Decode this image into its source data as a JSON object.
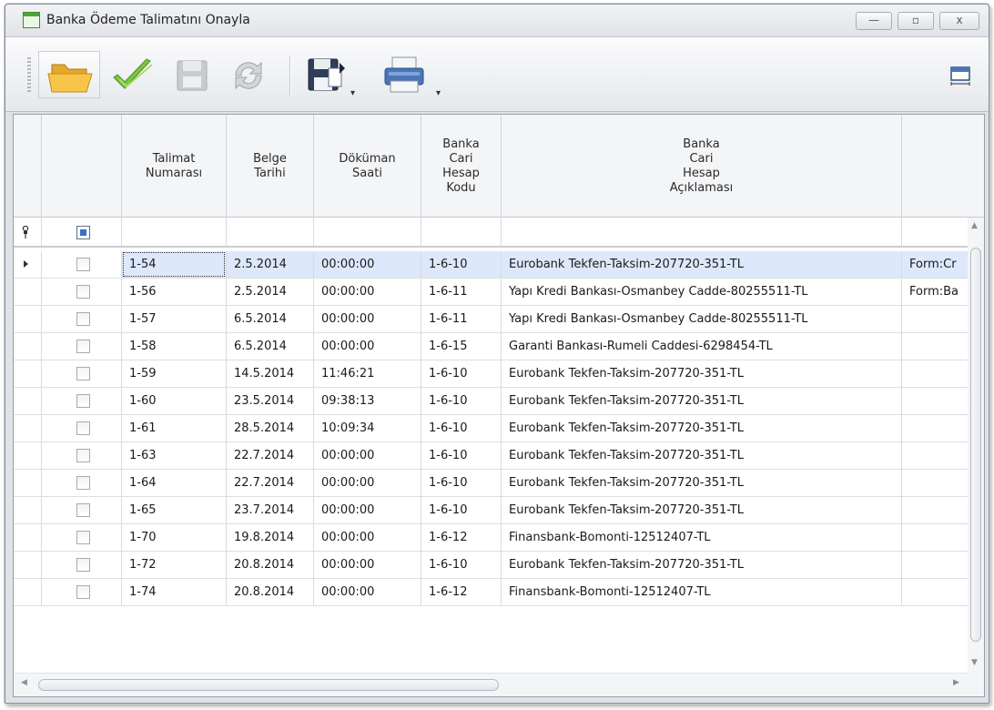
{
  "window": {
    "title": "Banka Ödeme Talimatını Onayla",
    "buttons": {
      "minimize": "—",
      "maximize": "▫",
      "close": "x"
    }
  },
  "toolbar": {
    "icons": [
      "folder-open-icon",
      "checkmark-icon",
      "save-icon",
      "refresh-icon",
      "export-icon",
      "print-icon",
      "column-fit-icon"
    ]
  },
  "grid": {
    "columns": [
      {
        "key": "indicator",
        "label": ""
      },
      {
        "key": "select",
        "label": ""
      },
      {
        "key": "talimat_no",
        "label": "Talimat\nNumarası"
      },
      {
        "key": "belge_tarihi",
        "label": "Belge\nTarihi"
      },
      {
        "key": "dokuman_saati",
        "label": "Döküman\nSaati"
      },
      {
        "key": "cari_kodu",
        "label": "Banka\nCari\nHesap\nKodu"
      },
      {
        "key": "cari_aciklama",
        "label": "Banka\nCari\nHesap\nAçıklaması"
      },
      {
        "key": "extra",
        "label": ""
      }
    ],
    "rows": [
      {
        "talimat_no": "1-54",
        "belge_tarihi": "2.5.2014",
        "dokuman_saati": "00:00:00",
        "cari_kodu": "1-6-10",
        "cari_aciklama": "Eurobank Tekfen-Taksim-207720-351-TL",
        "extra": "Form:Cr"
      },
      {
        "talimat_no": "1-56",
        "belge_tarihi": "2.5.2014",
        "dokuman_saati": "00:00:00",
        "cari_kodu": "1-6-11",
        "cari_aciklama": "Yapı Kredi Bankası-Osmanbey Cadde-80255511-TL",
        "extra": "Form:Ba"
      },
      {
        "talimat_no": "1-57",
        "belge_tarihi": "6.5.2014",
        "dokuman_saati": "00:00:00",
        "cari_kodu": "1-6-11",
        "cari_aciklama": "Yapı Kredi Bankası-Osmanbey Cadde-80255511-TL",
        "extra": ""
      },
      {
        "talimat_no": "1-58",
        "belge_tarihi": "6.5.2014",
        "dokuman_saati": "00:00:00",
        "cari_kodu": "1-6-15",
        "cari_aciklama": "Garanti Bankası-Rumeli Caddesi-6298454-TL",
        "extra": ""
      },
      {
        "talimat_no": "1-59",
        "belge_tarihi": "14.5.2014",
        "dokuman_saati": "11:46:21",
        "cari_kodu": "1-6-10",
        "cari_aciklama": "Eurobank Tekfen-Taksim-207720-351-TL",
        "extra": ""
      },
      {
        "talimat_no": "1-60",
        "belge_tarihi": "23.5.2014",
        "dokuman_saati": "09:38:13",
        "cari_kodu": "1-6-10",
        "cari_aciklama": "Eurobank Tekfen-Taksim-207720-351-TL",
        "extra": ""
      },
      {
        "talimat_no": "1-61",
        "belge_tarihi": "28.5.2014",
        "dokuman_saati": "10:09:34",
        "cari_kodu": "1-6-10",
        "cari_aciklama": "Eurobank Tekfen-Taksim-207720-351-TL",
        "extra": ""
      },
      {
        "talimat_no": "1-63",
        "belge_tarihi": "22.7.2014",
        "dokuman_saati": "00:00:00",
        "cari_kodu": "1-6-10",
        "cari_aciklama": "Eurobank Tekfen-Taksim-207720-351-TL",
        "extra": ""
      },
      {
        "talimat_no": "1-64",
        "belge_tarihi": "22.7.2014",
        "dokuman_saati": "00:00:00",
        "cari_kodu": "1-6-10",
        "cari_aciklama": "Eurobank Tekfen-Taksim-207720-351-TL",
        "extra": ""
      },
      {
        "talimat_no": "1-65",
        "belge_tarihi": "23.7.2014",
        "dokuman_saati": "00:00:00",
        "cari_kodu": "1-6-10",
        "cari_aciklama": "Eurobank Tekfen-Taksim-207720-351-TL",
        "extra": ""
      },
      {
        "talimat_no": "1-70",
        "belge_tarihi": "19.8.2014",
        "dokuman_saati": "00:00:00",
        "cari_kodu": "1-6-12",
        "cari_aciklama": "Finansbank-Bomonti-12512407-TL",
        "extra": ""
      },
      {
        "talimat_no": "1-72",
        "belge_tarihi": "20.8.2014",
        "dokuman_saati": "00:00:00",
        "cari_kodu": "1-6-10",
        "cari_aciklama": "Eurobank Tekfen-Taksim-207720-351-TL",
        "extra": ""
      },
      {
        "talimat_no": "1-74",
        "belge_tarihi": "20.8.2014",
        "dokuman_saati": "00:00:00",
        "cari_kodu": "1-6-12",
        "cari_aciklama": "Finansbank-Bomonti-12512407-TL",
        "extra": ""
      }
    ]
  },
  "colors": {
    "selected_row": "#dde8fb",
    "accent_green": "#4aa836",
    "checkbox_indeterminate": "#3a6fc8"
  }
}
